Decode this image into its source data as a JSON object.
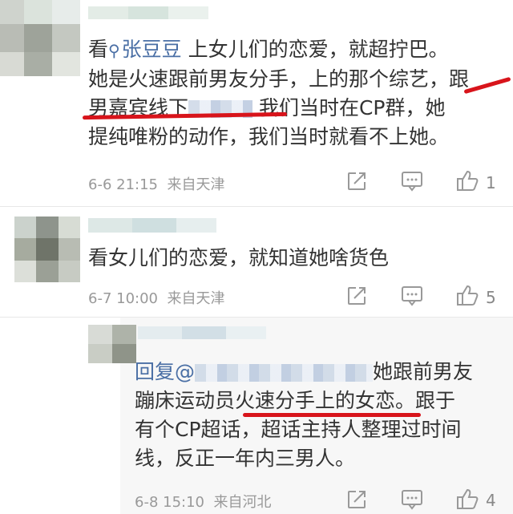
{
  "comment1": {
    "prefix": "看",
    "mention": "张豆豆",
    "lines": [
      "上女儿们的恋爱，就超拧巴。",
      "她是火速跟前男友分手，上的那个综艺，跟",
      "男嘉宾线下",
      "我们当时在CP群，她",
      "提纯唯粉的动作，我们当时就看不上她。"
    ],
    "time": "6-6 21:15",
    "location": "来自天津",
    "likes": "1"
  },
  "comment2": {
    "text": "看女儿们的恋爱，就知道她啥货色",
    "time": "6-7 10:00",
    "location": "来自天津",
    "likes": "5"
  },
  "reply": {
    "prefix": "回复@",
    "lines": [
      "她跟前男友",
      "蹦床运动员火速分手上的女恋。跟于",
      "有个CP超话，超话主持人整理过时间",
      "线，反正一年内三男人。"
    ],
    "time": "6-8 15:10",
    "location": "来自河北",
    "likes": "4"
  },
  "icons": [
    "share-icon",
    "comment-icon",
    "like-icon"
  ],
  "colors": {
    "mention": "#4a6fa5",
    "underline": "#d8141b",
    "meta": "#999999"
  }
}
